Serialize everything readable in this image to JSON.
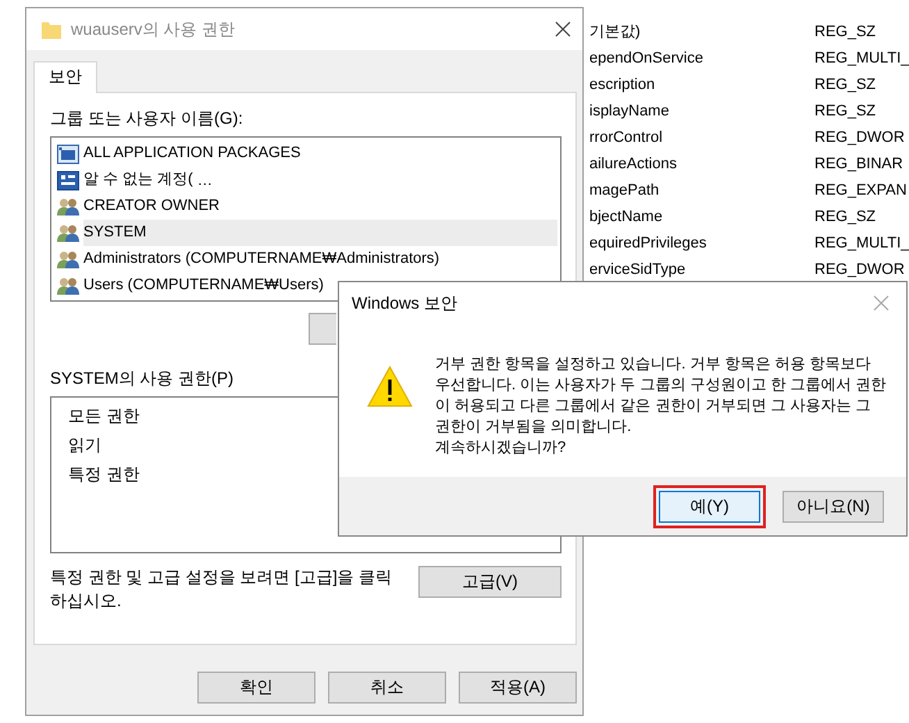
{
  "registry": {
    "rows": [
      {
        "name": "기본값)",
        "type": "REG_SZ"
      },
      {
        "name": "ependOnService",
        "type": "REG_MULTI_"
      },
      {
        "name": "escription",
        "type": "REG_SZ"
      },
      {
        "name": "isplayName",
        "type": "REG_SZ"
      },
      {
        "name": "rrorControl",
        "type": "REG_DWOR"
      },
      {
        "name": "ailureActions",
        "type": "REG_BINAR"
      },
      {
        "name": "magePath",
        "type": "REG_EXPAN"
      },
      {
        "name": "bjectName",
        "type": "REG_SZ"
      },
      {
        "name": "equiredPrivileges",
        "type": "REG_MULTI_"
      },
      {
        "name": "erviceSidType",
        "type": "REG_DWOR"
      }
    ]
  },
  "permissions_dialog": {
    "title": "wuauserv의 사용 권한",
    "tabs": [
      {
        "label": "보안",
        "selected": true
      }
    ],
    "groups_label": "그룹 또는 사용자 이름(G):",
    "groups": [
      {
        "kind": "package",
        "name": "ALL APPLICATION PACKAGES",
        "selected": false
      },
      {
        "kind": "account",
        "name": "알 수 없는 계정(",
        "suffix": "…",
        "selected": false
      },
      {
        "kind": "users",
        "name": "CREATOR OWNER",
        "selected": false
      },
      {
        "kind": "users",
        "name": "SYSTEM",
        "selected": true
      },
      {
        "kind": "users",
        "name": "Administrators (COMPUTERNAME₩Administrators)",
        "selected": false
      },
      {
        "kind": "users",
        "name": "Users (COMPUTERNAME₩Users)",
        "selected": false
      }
    ],
    "permissions_label": "SYSTEM의 사용 권한(P)",
    "permissions": [
      "모든 권한",
      "읽기",
      "특정 권한"
    ],
    "advanced_hint": "특정 권한 및 고급 설정을 보려면 [고급]을 클릭하십시오.",
    "advanced_button": "고급(V)",
    "buttons": [
      "확인",
      "취소",
      "적용(A)"
    ]
  },
  "message_box": {
    "title": "Windows 보안",
    "message": "거부 권한 항목을 설정하고 있습니다. 거부 항목은 허용 항목보다 우선합니다. 이는 사용자가 두 그룹의 구성원이고 한 그룹에서 권한이 허용되고 다른 그룹에서 같은 권한이 거부되면 그 사용자는 그 권한이 거부됨을 의미합니다.",
    "question": "계속하시겠습니까?",
    "buttons": [
      {
        "label": "예(Y)",
        "default": true,
        "highlighted": true
      },
      {
        "label": "아니요(N)",
        "default": false,
        "highlighted": false
      }
    ]
  }
}
